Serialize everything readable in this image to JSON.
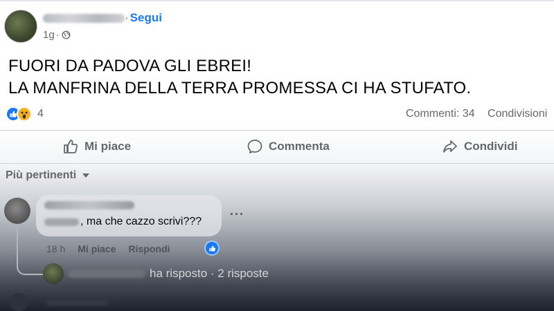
{
  "post": {
    "follow_label": "Segui",
    "name_separator": "·",
    "time": "1g",
    "time_separator": "·",
    "audience_icon": "globe-icon",
    "text_lines": [
      "FUORI DA PADOVA GLI EBREI!",
      "LA MANFRINA DELLA TERRA PROMESSA CI HA STUFATO."
    ],
    "reactions": {
      "icons": [
        "like-icon",
        "wow-icon"
      ],
      "count": "4"
    },
    "stats": {
      "comments": "Commenti: 34",
      "shares": "Condivisioni"
    }
  },
  "actions": {
    "like": "Mi piace",
    "comment": "Commenta",
    "share": "Condividi"
  },
  "sort": {
    "label": "Più pertinenti"
  },
  "comment": {
    "text": ", ma che cazzo scrivi???",
    "time": "18 h",
    "like_label": "Mi piace",
    "reply_label": "Rispondi",
    "more_label": "···"
  },
  "replies": {
    "text": "ha risposto · 2 risposte"
  },
  "colors": {
    "accent": "#1877f2",
    "secondary_text": "#65676b",
    "wow_yellow": "#f7b125"
  }
}
